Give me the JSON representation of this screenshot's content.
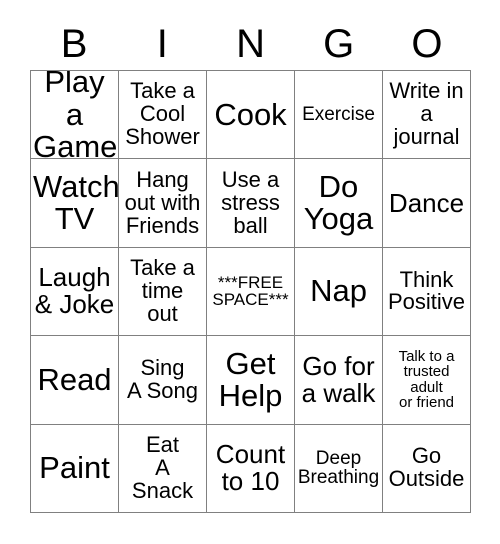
{
  "card": {
    "title_letters": [
      "B",
      "I",
      "N",
      "G",
      "O"
    ],
    "columns": 5,
    "rows": 5,
    "colors": {
      "background": "#ffffff",
      "cell_background": "#ffffff",
      "grid_line": "#808080",
      "text": "#000000"
    },
    "cells": [
      {
        "text": "Play a\nGame",
        "size": "xl",
        "row": 1,
        "col": 1,
        "free_space": false
      },
      {
        "text": "Take a\nCool\nShower",
        "size": "md",
        "row": 1,
        "col": 2,
        "free_space": false
      },
      {
        "text": "Cook",
        "size": "xl",
        "row": 1,
        "col": 3,
        "free_space": false
      },
      {
        "text": "Exercise",
        "size": "sm",
        "row": 1,
        "col": 4,
        "free_space": false
      },
      {
        "text": "Write in\na\njournal",
        "size": "md",
        "row": 1,
        "col": 5,
        "free_space": false
      },
      {
        "text": "Watch\nTV",
        "size": "xl",
        "row": 2,
        "col": 1,
        "free_space": false
      },
      {
        "text": "Hang\nout with\nFriends",
        "size": "md",
        "row": 2,
        "col": 2,
        "free_space": false
      },
      {
        "text": "Use a\nstress\nball",
        "size": "md",
        "row": 2,
        "col": 3,
        "free_space": false
      },
      {
        "text": "Do\nYoga",
        "size": "xl",
        "row": 2,
        "col": 4,
        "free_space": false
      },
      {
        "text": "Dance",
        "size": "lg",
        "row": 2,
        "col": 5,
        "free_space": false
      },
      {
        "text": "Laugh\n& Joke",
        "size": "lg",
        "row": 3,
        "col": 1,
        "free_space": false
      },
      {
        "text": "Take a\ntime\nout",
        "size": "md",
        "row": 3,
        "col": 2,
        "free_space": false
      },
      {
        "text": "***FREE\nSPACE***",
        "size": "xs",
        "row": 3,
        "col": 3,
        "free_space": true
      },
      {
        "text": "Nap",
        "size": "xl",
        "row": 3,
        "col": 4,
        "free_space": false
      },
      {
        "text": "Think\nPositive",
        "size": "md",
        "row": 3,
        "col": 5,
        "free_space": false
      },
      {
        "text": "Read",
        "size": "xl",
        "row": 4,
        "col": 1,
        "free_space": false
      },
      {
        "text": "Sing\nA Song",
        "size": "md",
        "row": 4,
        "col": 2,
        "free_space": false
      },
      {
        "text": "Get\nHelp",
        "size": "xl",
        "row": 4,
        "col": 3,
        "free_space": false
      },
      {
        "text": "Go for\na walk",
        "size": "lg",
        "row": 4,
        "col": 4,
        "free_space": false
      },
      {
        "text": "Talk to a\ntrusted\nadult\nor friend",
        "size": "xxs",
        "row": 4,
        "col": 5,
        "free_space": false
      },
      {
        "text": "Paint",
        "size": "xl",
        "row": 5,
        "col": 1,
        "free_space": false
      },
      {
        "text": "Eat\nA\nSnack",
        "size": "md",
        "row": 5,
        "col": 2,
        "free_space": false
      },
      {
        "text": "Count\nto 10",
        "size": "lg",
        "row": 5,
        "col": 3,
        "free_space": false
      },
      {
        "text": "Deep\nBreathing",
        "size": "sm",
        "row": 5,
        "col": 4,
        "free_space": false
      },
      {
        "text": "Go\nOutside",
        "size": "md",
        "row": 5,
        "col": 5,
        "free_space": false
      }
    ]
  }
}
